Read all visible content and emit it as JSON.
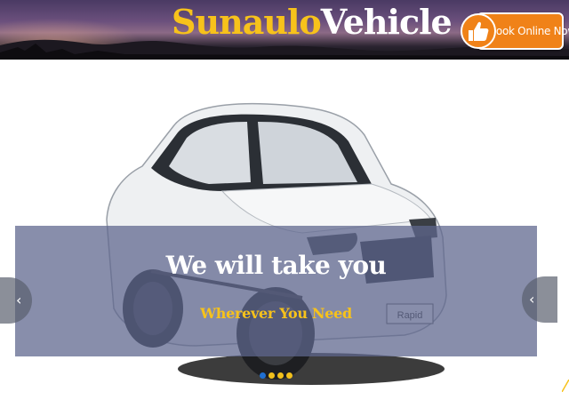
{
  "header": {
    "brand_part1": "Sunaulo",
    "brand_part2": "Vehicle",
    "book_button_label": "Book Online Now"
  },
  "carousel": {
    "caption_title": "We will take you",
    "caption_subtitle": "Wherever You Need",
    "slide_count": 4,
    "active_slide": 1,
    "car_plate": "Rapid",
    "prev_icon": "chevron-left-icon",
    "next_icon": "chevron-right-icon"
  },
  "colors": {
    "brand_yellow": "#f7c21b",
    "button_orange": "#f08218",
    "caption_overlay": "#5f678e",
    "indicator_active": "#1f6fd1"
  }
}
